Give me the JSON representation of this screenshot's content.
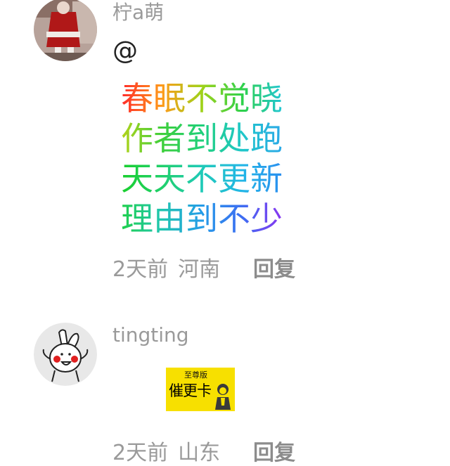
{
  "comments": [
    {
      "username": "柠a萌",
      "mention": "@",
      "poem_lines": [
        "春眠不觉晓",
        "作者到处跑",
        "天天不更新",
        "理由到不少"
      ],
      "time": "2天前",
      "location": "河南",
      "reply_label": "回复"
    },
    {
      "username": "tingting",
      "sticker": {
        "top_text": "至尊版",
        "main_text": "催更卡"
      },
      "time": "2天前",
      "location": "山东",
      "reply_label": "回复"
    }
  ]
}
